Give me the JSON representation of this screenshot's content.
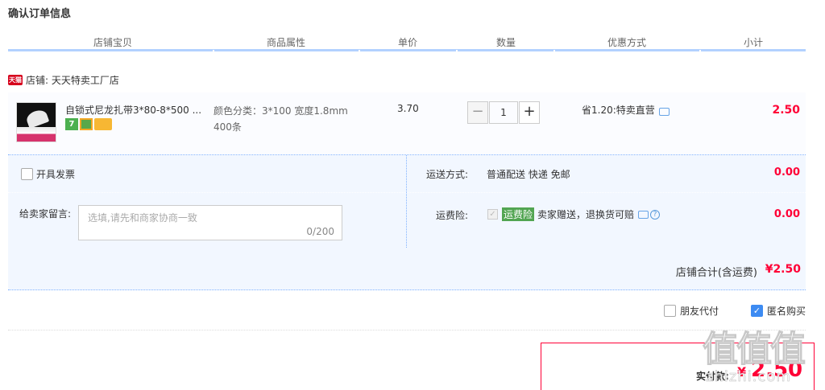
{
  "page": {
    "title": "确认订单信息"
  },
  "table_header": {
    "columns": [
      "店铺宝贝",
      "商品属性",
      "单价",
      "数量",
      "优惠方式",
      "小计"
    ]
  },
  "shop": {
    "badge": "天猫",
    "label": "店铺: 天天特卖工厂店"
  },
  "item": {
    "name": "自锁式尼龙扎带3*80-8*500 ...",
    "icons": [
      "seven-day-return-icon",
      "guarantee-icon",
      "credit-card-icon"
    ],
    "icon_seven": "7",
    "attr_line1": "颜色分类：3*100 宽度1.8mm",
    "attr_line2": "400条",
    "unit_price": "3.70",
    "quantity": "1",
    "qty_minus": "−",
    "qty_plus": "+",
    "discount": "省1.20:特卖直营",
    "subtotal": "2.50"
  },
  "options": {
    "invoice_label": "开具发票",
    "message_label": "给卖家留言:",
    "message_placeholder": "选填,请先和商家协商一致",
    "message_count": "0/200",
    "shipping_label": "运送方式:",
    "shipping_value": "普通配送 快递 免邮",
    "shipping_fee": "0.00",
    "insurance_label": "运费险:",
    "insurance_tag": "运费险",
    "insurance_desc": "卖家赠送，退换货可赔",
    "insurance_fee": "0.00"
  },
  "shop_total": {
    "label": "店铺合计(含运费)",
    "value": "¥2.50"
  },
  "extras": {
    "friend_pay_label": "朋友代付",
    "anonymous_label": "匿名购买",
    "anonymous_checked": true
  },
  "payment": {
    "label": "实付款:",
    "yen": "¥",
    "value": "2.50"
  },
  "watermark": {
    "text": "值值值",
    "sub": "zhizhi.com"
  },
  "colors": {
    "accent_red": "#ff0036",
    "header_line": "#b2d1ff",
    "panel_bg": "#f2f7ff",
    "checkbox_blue": "#3d8bf2"
  }
}
